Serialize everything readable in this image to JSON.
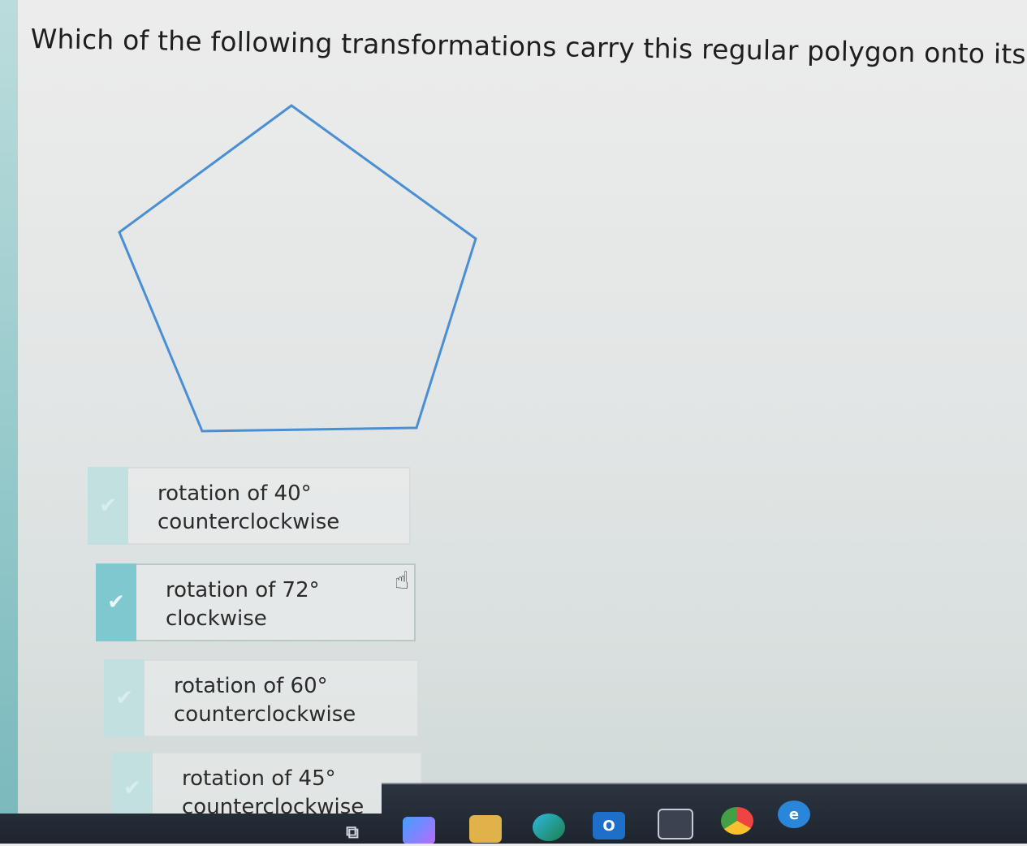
{
  "question": {
    "text": "Which of the following transformations carry this regular polygon onto itself?"
  },
  "figure": {
    "shape": "regular pentagon",
    "stroke_color": "#4a8fd4"
  },
  "choices": [
    {
      "line1": "rotation of 40°",
      "line2": "counterclockwise",
      "selected": false
    },
    {
      "line1": "rotation of 72°",
      "line2": "clockwise",
      "selected": true
    },
    {
      "line1": "rotation of 60°",
      "line2": "counterclockwise",
      "selected": false
    },
    {
      "line1": "rotation of 45°",
      "line2": "counterclockwise",
      "selected": false
    }
  ],
  "icons": {
    "check": "check-icon",
    "cursor": "hand-pointer-icon"
  },
  "taskbar": {
    "apps": [
      {
        "name": "task-view-icon"
      },
      {
        "name": "copilot-icon"
      },
      {
        "name": "file-explorer-icon"
      },
      {
        "name": "edge-icon"
      },
      {
        "name": "outlook-icon",
        "label": "O"
      },
      {
        "name": "store-icon"
      },
      {
        "name": "chrome-icon"
      },
      {
        "name": "ie-icon",
        "label": "e"
      }
    ]
  },
  "colors": {
    "accent_selected": "#80c8cf",
    "accent_unselected": "#c3e0e1",
    "pentagon_stroke": "#4a8fd4"
  }
}
